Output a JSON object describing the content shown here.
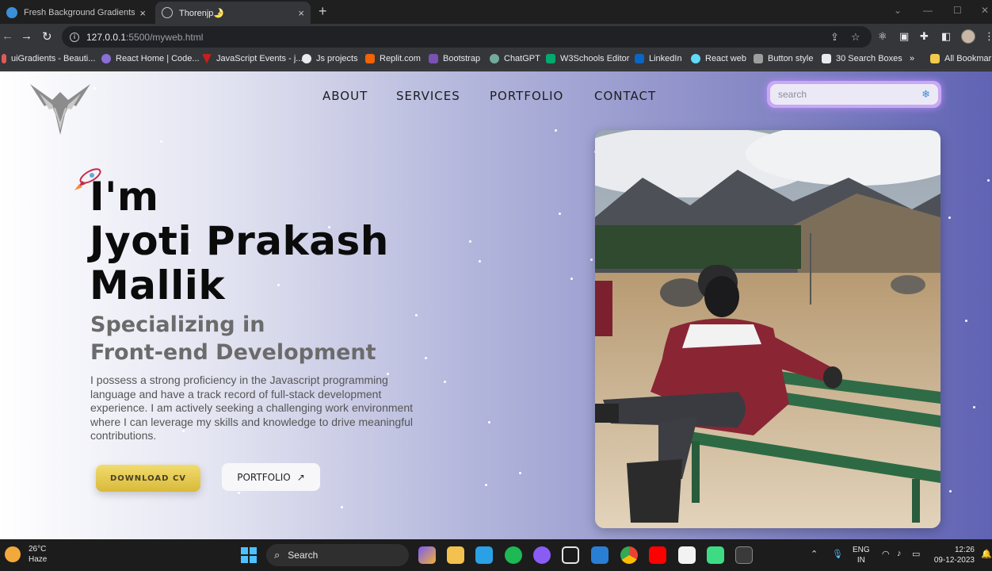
{
  "browser": {
    "tabs": [
      {
        "title": "Fresh Background Gradients | W",
        "close": "×"
      },
      {
        "title": "Thorenjp🌛",
        "close": "×"
      }
    ],
    "new_tab": "+",
    "window_buttons": [
      "—",
      "☐",
      "✕"
    ],
    "url_host": "127.0.0.1",
    "url_path": ":5500/myweb.html",
    "bookmarks": [
      {
        "label": "uiGradients - Beauti...",
        "color": "#e05a5a"
      },
      {
        "label": "React Home | Code...",
        "color": "#8a6fd6"
      },
      {
        "label": "JavaScript Events - j...",
        "color": "#c81e1e"
      },
      {
        "label": "Js projects",
        "color": "#e8eaed"
      },
      {
        "label": "Replit.com",
        "color": "#f26207"
      },
      {
        "label": "Bootstrap",
        "color": "#7952b3"
      },
      {
        "label": "ChatGPT",
        "color": "#74aa9c"
      },
      {
        "label": "W3Schools Editor",
        "color": "#04aa6d"
      },
      {
        "label": "LinkedIn",
        "color": "#0a66c2"
      },
      {
        "label": "React web",
        "color": "#61dafb"
      },
      {
        "label": "Button style",
        "color": "#9e9e9e"
      },
      {
        "label": "30 Search Boxes",
        "color": "#e8eaed"
      }
    ],
    "bookmarks_more": "»",
    "all_bookmarks": "All Bookmarks"
  },
  "site": {
    "nav": [
      "ABOUT",
      "SERVICES",
      "PORTFOLIO",
      "CONTACT"
    ],
    "search_placeholder": "search",
    "hero": {
      "line1": "I'm",
      "line2": "Jyoti Prakash",
      "line3": "Mallik",
      "sub1": "Specializing in",
      "sub2": "Front-end Development",
      "description": "I possess a strong proficiency in the Javascript programming language and have a track record of full-stack development experience. I am actively seeking a challenging work environment where I can leverage my skills and knowledge to drive meaningful contributions."
    },
    "buttons": {
      "download_cv": "DOWNLOAD CV",
      "portfolio": "PORTFOLIO",
      "portfolio_arrow": "↗"
    }
  },
  "taskbar": {
    "weather_temp": "26°C",
    "weather_desc": "Haze",
    "search_label": "Search",
    "lang_line1": "ENG",
    "lang_line2": "IN",
    "time": "12:26",
    "date": "09-12-2023"
  }
}
